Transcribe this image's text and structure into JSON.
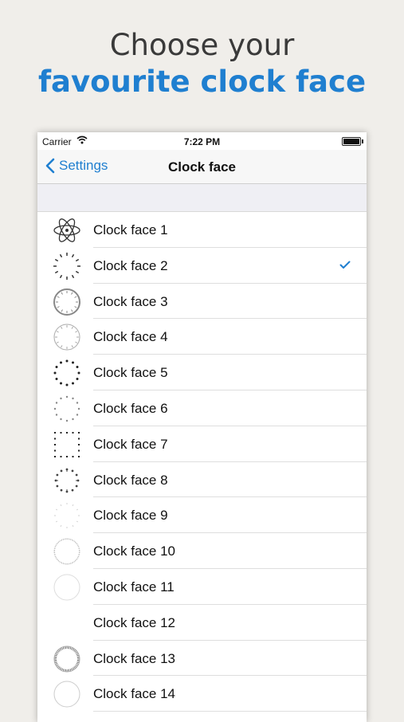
{
  "promo": {
    "line1": "Choose your",
    "line2": "favourite clock face"
  },
  "status_bar": {
    "carrier": "Carrier",
    "time": "7:22 PM"
  },
  "nav": {
    "back_label": "Settings",
    "title": "Clock face"
  },
  "accent_color": "#1f7fd0",
  "selected_index": 1,
  "items": [
    {
      "label": "Clock face 1",
      "icon": "atom-icon"
    },
    {
      "label": "Clock face 2",
      "icon": "tick-dial-icon"
    },
    {
      "label": "Clock face 3",
      "icon": "ring-dial-icon"
    },
    {
      "label": "Clock face 4",
      "icon": "thin-ring-dial-icon"
    },
    {
      "label": "Clock face 5",
      "icon": "numeral-dial-icon"
    },
    {
      "label": "Clock face 6",
      "icon": "light-numeral-dial-icon"
    },
    {
      "label": "Clock face 7",
      "icon": "square-dot-dial-icon"
    },
    {
      "label": "Clock face 8",
      "icon": "dot-numeral-dial-icon"
    },
    {
      "label": "Clock face 9",
      "icon": "faint-dial-icon"
    },
    {
      "label": "Clock face 10",
      "icon": "fine-tick-dial-icon"
    },
    {
      "label": "Clock face 11",
      "icon": "faint-ring-dial-icon"
    },
    {
      "label": "Clock face 12",
      "icon": ""
    },
    {
      "label": "Clock face 13",
      "icon": "roman-ring-dial-icon"
    },
    {
      "label": "Clock face 14",
      "icon": "plain-ring-dial-icon"
    }
  ]
}
